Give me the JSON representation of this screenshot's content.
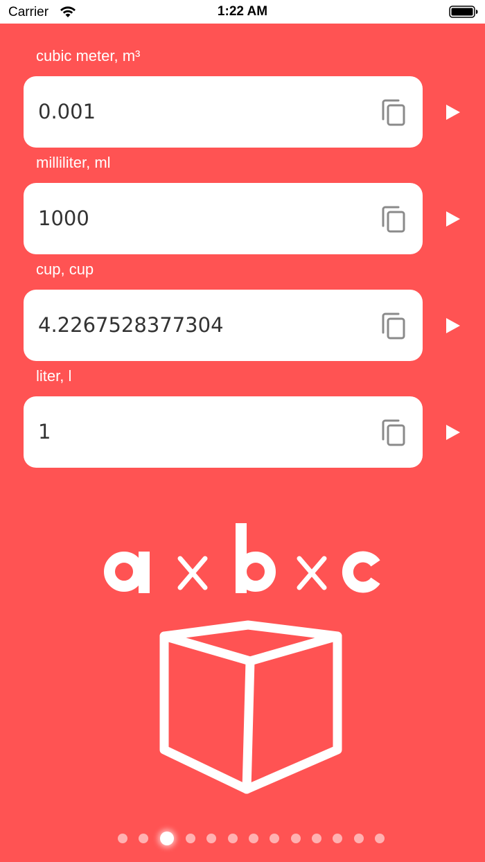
{
  "status_bar": {
    "carrier": "Carrier",
    "time": "1:22 AM"
  },
  "fields": [
    {
      "label": "cubic meter, m³",
      "value": "0.001"
    },
    {
      "label": "milliliter, ml",
      "value": "1000"
    },
    {
      "label": "cup, cup",
      "value": "4.2267528377304"
    },
    {
      "label": "liter, l",
      "value": "1"
    }
  ],
  "illustration": {
    "formula": "a×b×c"
  },
  "pager": {
    "count": 13,
    "active_index": 2
  },
  "colors": {
    "background": "#FF5353",
    "field_background": "#FFFFFF",
    "field_text": "#333333",
    "icon_gray": "#8A8A8A"
  }
}
